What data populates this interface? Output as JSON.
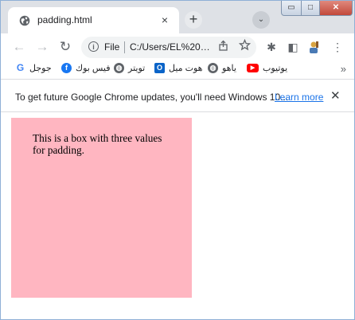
{
  "tab": {
    "title": "padding.html",
    "close_icon": "×"
  },
  "new_tab_icon": "+",
  "tab_search_icon": "⌄",
  "window_controls": {
    "minimize": "▭",
    "maximize": "□",
    "close": "✕"
  },
  "toolbar": {
    "back": "←",
    "forward": "→",
    "reload": "↻",
    "scheme": "File",
    "url": "C:/Users/EL%20…",
    "extensions_icon": "✱",
    "sidebar_icon": "◧",
    "menu_icon": "⋮"
  },
  "bookmarks": [
    {
      "label": "جوجل",
      "icon": "G",
      "color": "#ffffff"
    },
    {
      "label": "فيس بوك",
      "icon": "f",
      "color": "#1877f2"
    },
    {
      "label": "تويتر",
      "icon": "",
      "color": "#5f6368"
    },
    {
      "label": "هوت ميل",
      "icon": "O",
      "color": "#0a64c8"
    },
    {
      "label": "ياهو",
      "icon": "",
      "color": "#5f6368"
    },
    {
      "label": "يوتيوب",
      "icon": "▶",
      "color": "#ff0000"
    }
  ],
  "bookmarks_more": "»",
  "infobar": {
    "message": "To get future Google Chrome updates, you'll need Windows 10...",
    "link": "Learn more",
    "close": "✕"
  },
  "page": {
    "box_text": "This is a box with three values for padding.",
    "box_color": "#ffb6c1"
  }
}
